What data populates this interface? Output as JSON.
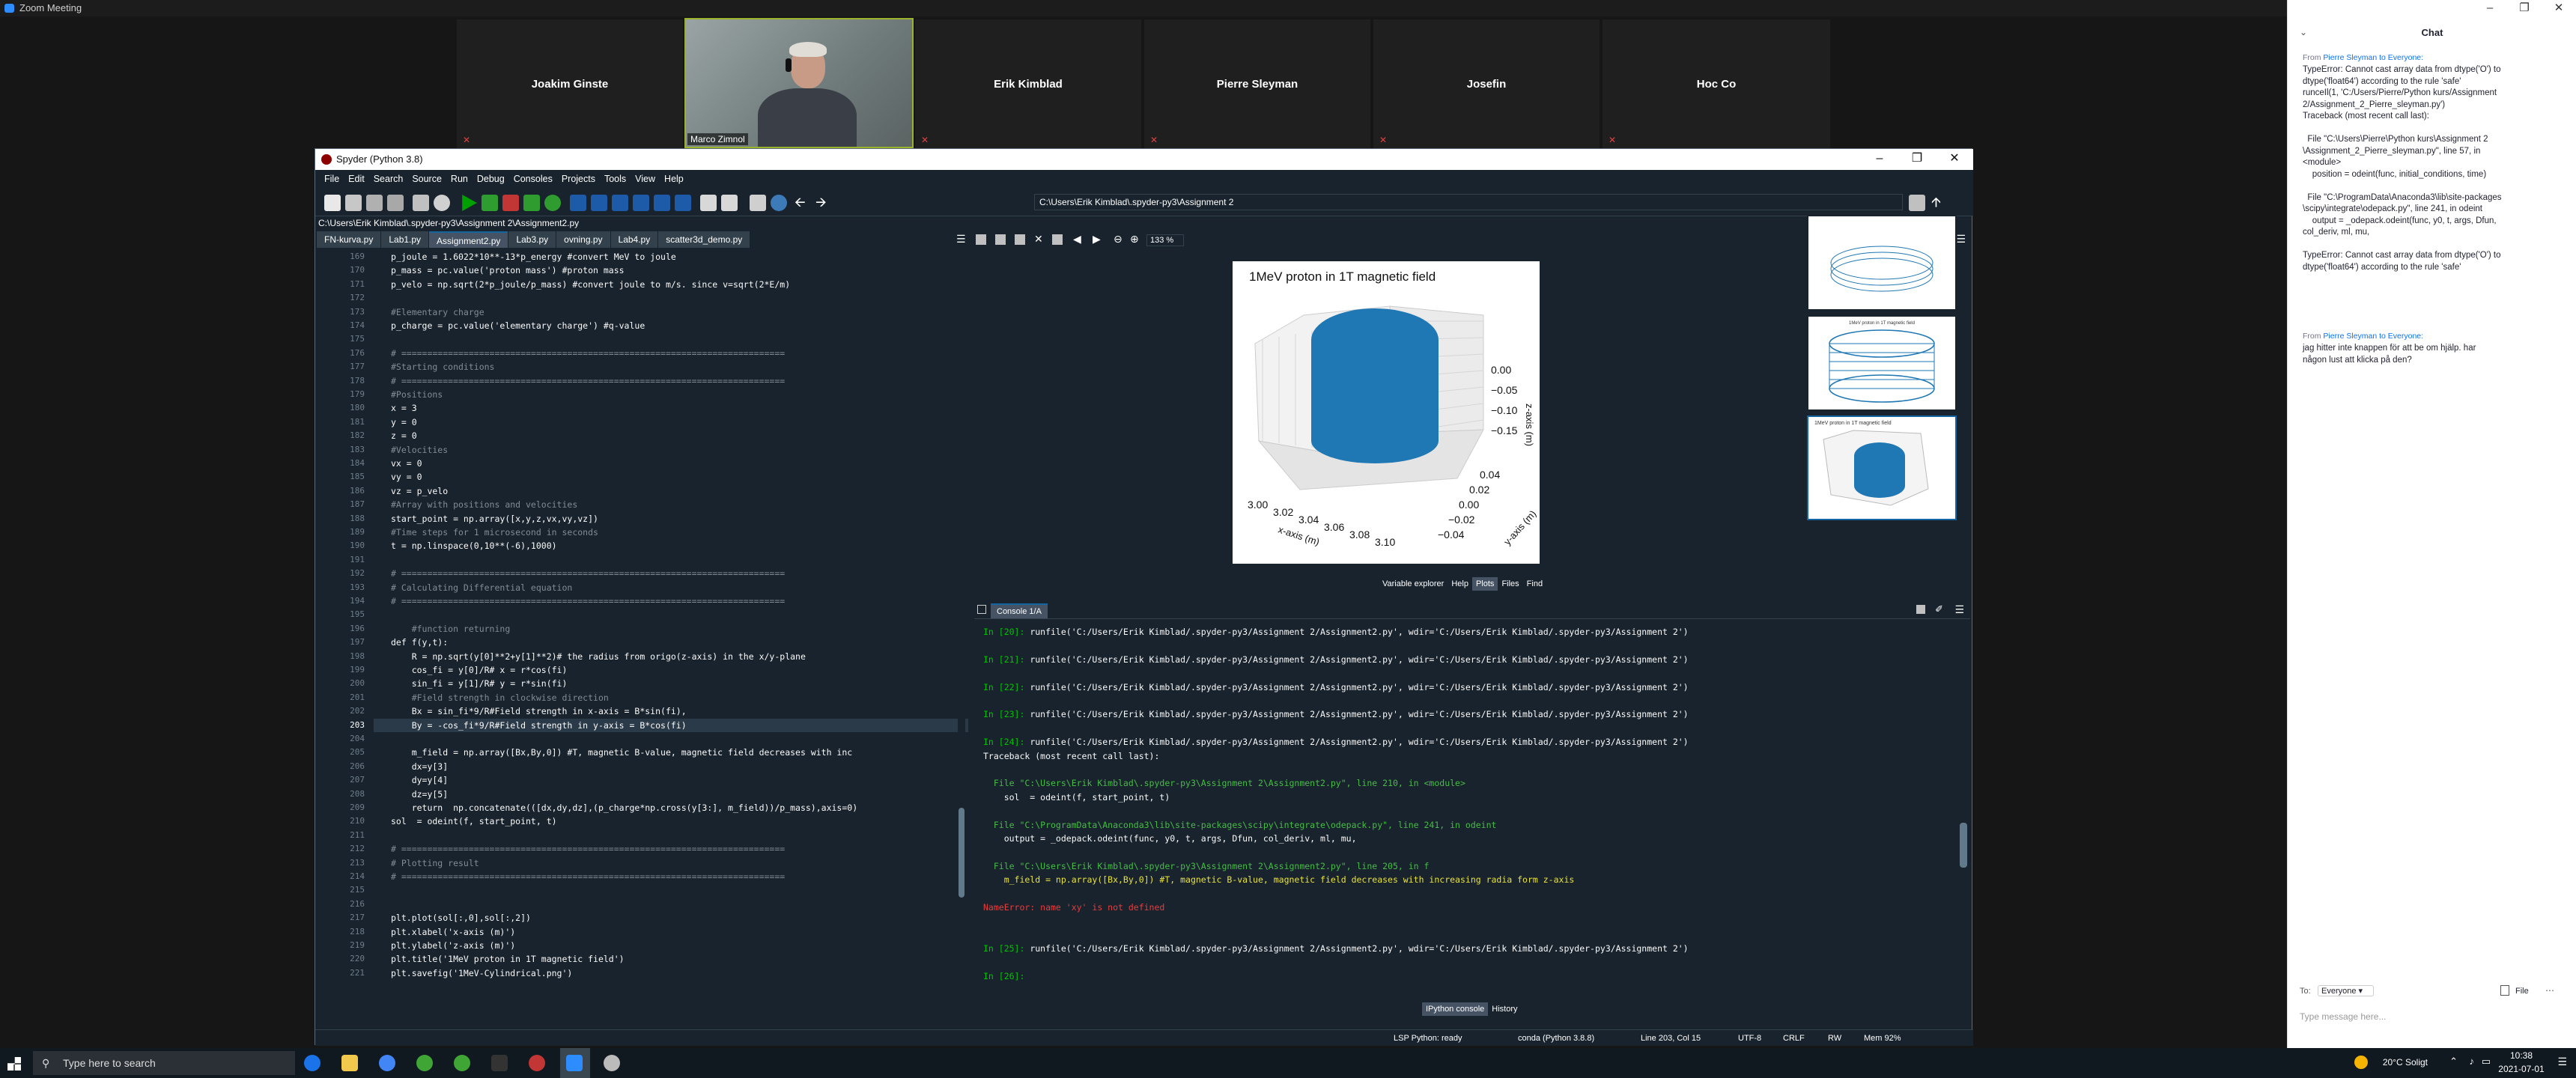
{
  "zoom": {
    "title": "Zoom Meeting",
    "participants": [
      "Joakim Ginste",
      "Erik Kimblad",
      "Pierre Sleyman",
      "Josefin",
      "Hoc Co"
    ],
    "video_name": "Marco Zimnol"
  },
  "spyder": {
    "title": "Spyder (Python 3.8)",
    "menu": [
      "File",
      "Edit",
      "Search",
      "Source",
      "Run",
      "Debug",
      "Consoles",
      "Projects",
      "Tools",
      "View",
      "Help"
    ],
    "path": "C:\\Users\\Erik Kimblad\\.spyder-py3\\Assignment 2",
    "crumb": "C:\\Users\\Erik Kimblad\\.spyder-py3\\Assignment 2\\Assignment2.py",
    "tabs": [
      "FN-kurva.py",
      "Lab1.py",
      "Assignment2.py",
      "Lab3.py",
      "ovning.py",
      "Lab4.py",
      "scatter3d_demo.py"
    ],
    "active_tab": 2,
    "editor_lines": [
      [
        "169",
        "p_joule = 1.6022*10**-13*p_energy #convert MeV to joule"
      ],
      [
        "170",
        "p_mass = pc.value('proton mass') #proton mass"
      ],
      [
        "171",
        "p_velo = np.sqrt(2*p_joule/p_mass) #convert joule to m/s. since v=sqrt(2*E/m)"
      ],
      [
        "172",
        ""
      ],
      [
        "173",
        "#Elementary charge"
      ],
      [
        "174",
        "p_charge = pc.value('elementary charge') #q-value"
      ],
      [
        "175",
        ""
      ],
      [
        "176",
        "# =========================================================================="
      ],
      [
        "177",
        "#Starting conditions"
      ],
      [
        "178",
        "# =========================================================================="
      ],
      [
        "179",
        "#Positions"
      ],
      [
        "180",
        "x = 3"
      ],
      [
        "181",
        "y = 0"
      ],
      [
        "182",
        "z = 0"
      ],
      [
        "183",
        "#Velocities"
      ],
      [
        "184",
        "vx = 0"
      ],
      [
        "185",
        "vy = 0"
      ],
      [
        "186",
        "vz = p_velo"
      ],
      [
        "187",
        "#Array with positions and velocities"
      ],
      [
        "188",
        "start_point = np.array([x,y,z,vx,vy,vz])"
      ],
      [
        "189",
        "#Time steps for 1 microsecond in seconds"
      ],
      [
        "190",
        "t = np.linspace(0,10**(-6),1000)"
      ],
      [
        "191",
        ""
      ],
      [
        "192",
        "# =========================================================================="
      ],
      [
        "193",
        "# Calculating Differential equation"
      ],
      [
        "194",
        "# =========================================================================="
      ],
      [
        "195",
        ""
      ],
      [
        "196",
        "    #function returning"
      ],
      [
        "197",
        "def f(y,t):"
      ],
      [
        "198",
        "    R = np.sqrt(y[0]**2+y[1]**2)# the radius from origo(z-axis) in the x/y-plane"
      ],
      [
        "199",
        "    cos_fi = y[0]/R# x = r*cos(fi)"
      ],
      [
        "200",
        "    sin_fi = y[1]/R# y = r*sin(fi)"
      ],
      [
        "201",
        "    #Field strength in clockwise direction"
      ],
      [
        "202",
        "    Bx = sin_fi*9/R#Field strength in x-axis = B*sin(fi),"
      ],
      [
        "203",
        "    By = -cos_fi*9/R#Field strength in y-axis = B*cos(fi)"
      ],
      [
        "204",
        ""
      ],
      [
        "205",
        "    m_field = np.array([Bx,By,0]) #T, magnetic B-value, magnetic field decreases with inc"
      ],
      [
        "206",
        "    dx=y[3]"
      ],
      [
        "207",
        "    dy=y[4]"
      ],
      [
        "208",
        "    dz=y[5]"
      ],
      [
        "209",
        "    return  np.concatenate(([dx,dy,dz],(p_charge*np.cross(y[3:], m_field))/p_mass),axis=0)"
      ],
      [
        "210",
        "sol  = odeint(f, start_point, t)"
      ],
      [
        "211",
        ""
      ],
      [
        "212",
        "# =========================================================================="
      ],
      [
        "213",
        "# Plotting result"
      ],
      [
        "214",
        "# =========================================================================="
      ],
      [
        "215",
        ""
      ],
      [
        "216",
        ""
      ],
      [
        "217",
        "plt.plot(sol[:,0],sol[:,2])"
      ],
      [
        "218",
        "plt.xlabel('x-axis (m)')"
      ],
      [
        "219",
        "plt.ylabel('z-axis (m)')"
      ],
      [
        "220",
        "plt.title('1MeV proton in 1T magnetic field')"
      ],
      [
        "221",
        "plt.savefig('1MeV-Cylindrical.png')"
      ]
    ],
    "zoom_level": "133 %",
    "panel_tabs": [
      "Variable explorer",
      "Help",
      "Plots",
      "Files",
      "Find"
    ],
    "console_tab": "Console 1/A",
    "console_lines": [
      {
        "p": "In [20]: ",
        "t": "runfile('C:/Users/Erik Kimblad/.spyder-py3/Assignment 2/Assignment2.py', wdir='C:/Users/Erik Kimblad/.spyder-py3/Assignment 2')"
      },
      {
        "p": "",
        "t": ""
      },
      {
        "p": "In [21]: ",
        "t": "runfile('C:/Users/Erik Kimblad/.spyder-py3/Assignment 2/Assignment2.py', wdir='C:/Users/Erik Kimblad/.spyder-py3/Assignment 2')"
      },
      {
        "p": "",
        "t": ""
      },
      {
        "p": "In [22]: ",
        "t": "runfile('C:/Users/Erik Kimblad/.spyder-py3/Assignment 2/Assignment2.py', wdir='C:/Users/Erik Kimblad/.spyder-py3/Assignment 2')"
      },
      {
        "p": "",
        "t": ""
      },
      {
        "p": "In [23]: ",
        "t": "runfile('C:/Users/Erik Kimblad/.spyder-py3/Assignment 2/Assignment2.py', wdir='C:/Users/Erik Kimblad/.spyder-py3/Assignment 2')"
      },
      {
        "p": "",
        "t": ""
      },
      {
        "p": "In [24]: ",
        "t": "runfile('C:/Users/Erik Kimblad/.spyder-py3/Assignment 2/Assignment2.py', wdir='C:/Users/Erik Kimblad/.spyder-py3/Assignment 2')"
      },
      {
        "p": "",
        "t": "Traceback (most recent call last):"
      },
      {
        "p": "",
        "t": ""
      },
      {
        "p": "",
        "t": "  File \"C:\\Users\\Erik Kimblad\\.spyder-py3\\Assignment 2\\Assignment2.py\", line 210, in <module>"
      },
      {
        "p": "",
        "t": "    sol  = odeint(f, start_point, t)"
      },
      {
        "p": "",
        "t": ""
      },
      {
        "p": "",
        "t": "  File \"C:\\ProgramData\\Anaconda3\\lib\\site-packages\\scipy\\integrate\\odepack.py\", line 241, in odeint"
      },
      {
        "p": "",
        "t": "    output = _odepack.odeint(func, y0, t, args, Dfun, col_deriv, ml, mu,"
      },
      {
        "p": "",
        "t": ""
      },
      {
        "p": "",
        "t": "  File \"C:\\Users\\Erik Kimblad\\.spyder-py3\\Assignment 2\\Assignment2.py\", line 205, in f"
      },
      {
        "p": "",
        "t": "    m_field = np.array([Bx,By,0]) #T, magnetic B-value, magnetic field decreases with increasing radia form z-axis"
      },
      {
        "p": "",
        "t": ""
      },
      {
        "p": "",
        "t": "NameError: name 'xy' is not defined"
      },
      {
        "p": "",
        "t": ""
      },
      {
        "p": "",
        "t": ""
      },
      {
        "p": "In [25]: ",
        "t": "runfile('C:/Users/Erik Kimblad/.spyder-py3/Assignment 2/Assignment2.py', wdir='C:/Users/Erik Kimblad/.spyder-py3/Assignment 2')"
      },
      {
        "p": "",
        "t": ""
      },
      {
        "p": "In [26]: ",
        "t": ""
      }
    ],
    "console_tabs": [
      "IPython console",
      "History"
    ],
    "status": [
      "LSP Python: ready",
      "conda (Python 3.8.8)",
      "Line 203, Col 15",
      "UTF-8",
      "CRLF",
      "RW",
      "Mem 92%"
    ]
  },
  "plot": {
    "title": "1MeV proton in 1T magnetic field",
    "xlabel": "x-axis (m)",
    "ylabel": "y-axis (m)",
    "zlabel": "z-axis (m)",
    "xticks": [
      "3.00",
      "3.02",
      "3.04",
      "3.06",
      "3.08",
      "3.10"
    ],
    "yticks": [
      "0.04",
      "0.02",
      "0.00",
      "−0.02",
      "−0.04"
    ],
    "zticks": [
      "0.00",
      "−0.05",
      "−0.10",
      "−0.15"
    ],
    "color": "#1f77b4"
  },
  "thumbs": {
    "t2_title": "1MeV proton in 1T magnetic field",
    "t3_title": "1MeV proton in 1T magnetic field"
  },
  "chat": {
    "title": "Chat",
    "msg1_from": "From ",
    "msg1_name": "Pierre Sleyman to Everyone:",
    "msg1": "TypeError: Cannot cast array data from dtype('O') to\ndtype('float64') according to the rule 'safe'\nrunceIl(1, 'C:/Users/Pierre/Python kurs/Assignment\n2/Assignment_2_Pierre_sleyman.py')\nTraceback (most recent call last):\n\n  File \"C:\\Users\\Pierre\\Python kurs\\Assignment 2\n\\Assignment_2_Pierre_sleyman.py\", line 57, in\n<module>\n    position = odeint(func, initial_conditions, time)\n\n  File \"C:\\ProgramData\\Anaconda3\\lib\\site-packages\n\\scipy\\integrate\\odepack.py\", line 241, in odeint\n    output = _odepack.odeint(func, y0, t, args, Dfun,\ncol_deriv, ml, mu,\n\nTypeError: Cannot cast array data from dtype('O') to\ndtype('float64') according to the rule 'safe'",
    "msg2_from": "From ",
    "msg2_name": "Pierre Sleyman to Everyone:",
    "msg2": "jag hitter inte knappen för att be om hjälp. har\nnågon lust att klicka på den?",
    "to_label": "To:",
    "to_value": "Everyone",
    "file_label": "File",
    "placeholder": "Type message here..."
  },
  "taskbar": {
    "search": "Type here to search",
    "weather": "20°C  Soligt",
    "time": "10:38",
    "date": "2021-07-01"
  }
}
